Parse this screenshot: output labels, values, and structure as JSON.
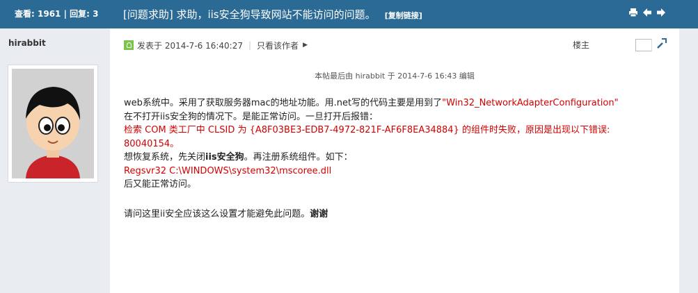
{
  "header": {
    "views_label": "查看:",
    "views": "1961",
    "replies_label": "回复:",
    "replies": "3",
    "title": "[问题求助] 求助，iis安全狗导致网站不能访问的问题。",
    "copy_link": "[复制链接]"
  },
  "sidebar": {
    "author": "hirabbit"
  },
  "post": {
    "posted_at": "发表于 2014-7-6 16:40:27",
    "only_author": "只看该作者",
    "floor": "楼主",
    "edited": "本帖最后由 hirabbit 于 2014-7-6 16:43 编辑",
    "lines": {
      "l1": "web系统中。采用了获取服务器mac的地址功能。用.net写的代码主要是用到了",
      "l1_red": "\"Win32_NetworkAdapterConfiguration\"",
      "l2": "在不打开iis安全狗的情况下。是能正常访问。一旦打开后报错：",
      "l3_red": "检索 COM 类工厂中 CLSID 为 {A8F03BE3-EDB7-4972-821F-AF6F8EA34884} 的组件时失败，原因是出现以下错误:",
      "l4_red": "80040154。",
      "l5_a": "想恢复系统，先关闭",
      "l5_b": "iis安全狗",
      "l5_c": "。再注册系统组件。如下：",
      "l6_red": "Regsvr32 C:\\WINDOWS\\system32\\mscoree.dll",
      "l7": "后又能正常访问。",
      "l8_a": "请问这里ii安全应该这么设置才能避免此问题。",
      "l8_b": "谢谢"
    }
  }
}
